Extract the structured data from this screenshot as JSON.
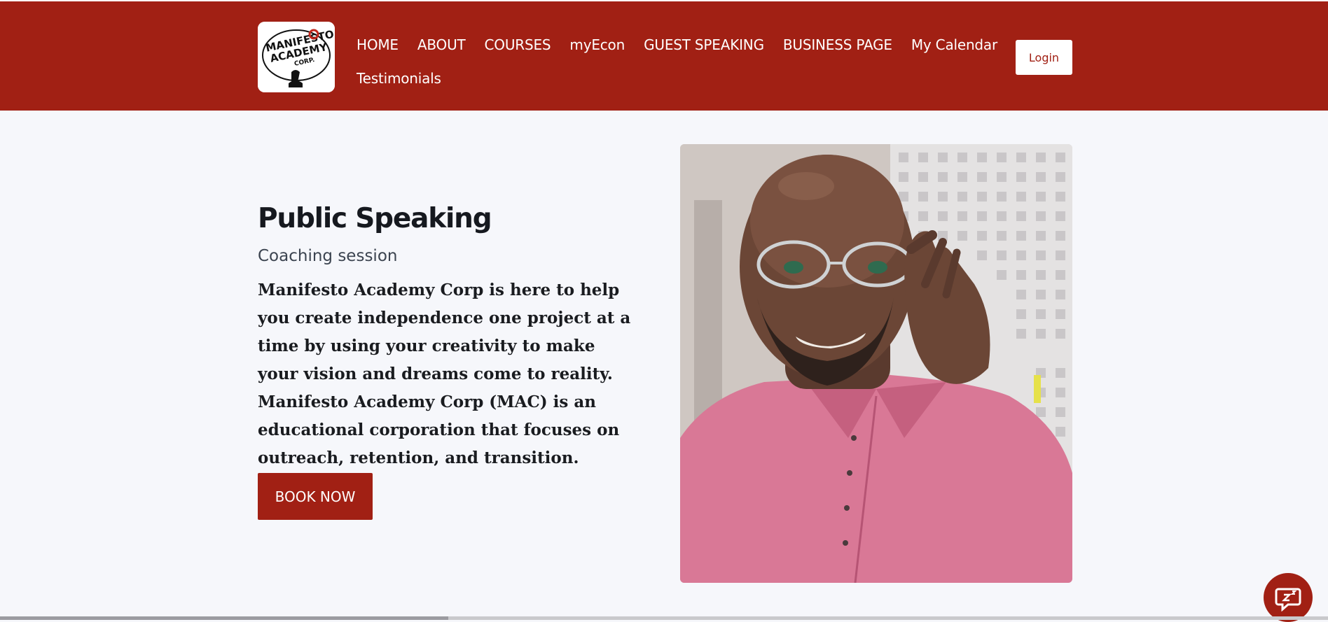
{
  "header": {
    "logo": {
      "icon": "manifesto-academy-logo-icon",
      "text_lines": [
        "MANIFESTO",
        "ACADEMY",
        "CORP."
      ]
    },
    "nav": {
      "row1": [
        "HOME",
        "ABOUT",
        "COURSES",
        "myEcon",
        "GUEST SPEAKING",
        "BUSINESS PAGE",
        "My Calendar"
      ],
      "row2": [
        "Testimonials"
      ]
    },
    "login_label": "Login"
  },
  "hero": {
    "title": "Public Speaking",
    "subtitle": "Coaching session",
    "body": "Manifesto Academy Corp is here to help you create independence one project at a time by using your creativity to make your vision and dreams come to reality. Manifesto Academy Corp (MAC) is an educational corporation that focuses on outreach, retention, and transition.",
    "cta_label": "BOOK NOW",
    "photo_icon": "portrait-photo"
  },
  "chat_widget": {
    "icon": "chat-bubble-icon"
  },
  "colors": {
    "brand": "#a12014",
    "background": "#f6f7fb",
    "text_dark": "#16191f",
    "white": "#ffffff"
  }
}
